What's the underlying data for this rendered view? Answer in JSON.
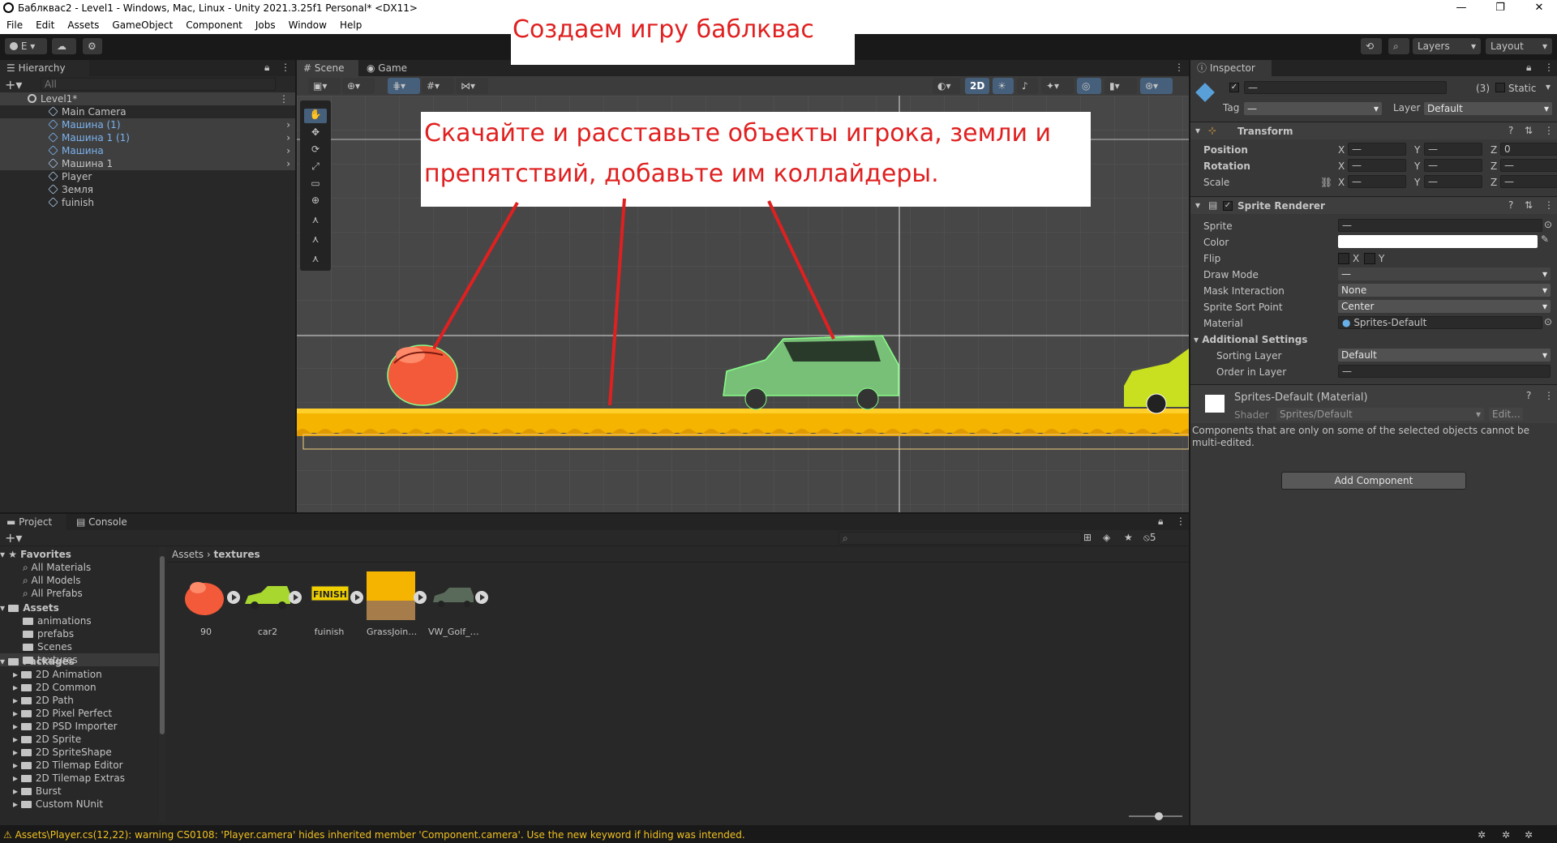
{
  "window": {
    "title": "Баблквас2 - Level1 - Windows, Mac, Linux - Unity 2021.3.25f1 Personal* <DX11>",
    "minimize": "—",
    "maximize": "❐",
    "close": "✕"
  },
  "menu": [
    "File",
    "Edit",
    "Assets",
    "GameObject",
    "Component",
    "Jobs",
    "Window",
    "Help"
  ],
  "toolbar": {
    "account": "E",
    "layers": "Layers",
    "layout": "Layout"
  },
  "overlay": {
    "title": "Создаем игру баблквас",
    "instruction": "Скачайте и расставьте объекты игрока, земли и препятствий, добавьте им коллайдеры.",
    "accent_color": "#e02020"
  },
  "hierarchy": {
    "tab": "Hierarchy",
    "search_placeholder": "All",
    "scene": "Level1*",
    "items": [
      {
        "name": "Main Camera",
        "prefab": false,
        "arrow": false
      },
      {
        "name": "Машина (1)",
        "prefab": true,
        "arrow": true
      },
      {
        "name": "Машина 1 (1)",
        "prefab": true,
        "arrow": true
      },
      {
        "name": "Машина",
        "prefab": true,
        "arrow": true
      },
      {
        "name": "Машина 1",
        "prefab": false,
        "arrow": true
      },
      {
        "name": "Player",
        "prefab": false,
        "arrow": false
      },
      {
        "name": "Земля",
        "prefab": false,
        "arrow": false
      },
      {
        "name": "fuinish",
        "prefab": false,
        "arrow": false
      }
    ]
  },
  "scene_view": {
    "tab_scene": "Scene",
    "tab_game": "Game",
    "mode_2d": "2D"
  },
  "inspector": {
    "tab": "Inspector",
    "name_value": "—",
    "multi_count": "(3)",
    "static_label": "Static",
    "tag_label": "Tag",
    "tag_value": "—",
    "layer_label": "Layer",
    "layer_value": "Default",
    "transform": {
      "title": "Transform",
      "position": "Position",
      "rotation": "Rotation",
      "scale": "Scale",
      "x": "X",
      "y": "Y",
      "z": "Z",
      "dash": "—",
      "pos_z": "0"
    },
    "sprite_renderer": {
      "title": "Sprite Renderer",
      "sprite": "Sprite",
      "sprite_value": "—",
      "color": "Color",
      "flip": "Flip",
      "flip_x": "X",
      "flip_y": "Y",
      "draw_mode": "Draw Mode",
      "draw_mode_value": "—",
      "mask_interaction": "Mask Interaction",
      "mask_value": "None",
      "sort_point": "Sprite Sort Point",
      "sort_point_value": "Center",
      "material": "Material",
      "material_value": "Sprites-Default",
      "additional": "Additional Settings",
      "sorting_layer": "Sorting Layer",
      "sorting_layer_value": "Default",
      "order": "Order in Layer",
      "order_value": "—"
    },
    "material_block": {
      "title": "Sprites-Default (Material)",
      "shader_label": "Shader",
      "shader_value": "Sprites/Default",
      "edit": "Edit..."
    },
    "note": "Components that are only on some of the selected objects cannot be multi-edited.",
    "add_component": "Add Component"
  },
  "project": {
    "tab_project": "Project",
    "tab_console": "Console",
    "breadcrumb_root": "Assets",
    "breadcrumb_sep": "›",
    "breadcrumb_current": "textures",
    "hidden_count": "5",
    "favorites_label": "Favorites",
    "favorites": [
      "All Materials",
      "All Models",
      "All Prefabs"
    ],
    "assets_label": "Assets",
    "assets": [
      "animations",
      "prefabs",
      "Scenes",
      "textures"
    ],
    "packages_label": "Packages",
    "packages": [
      "2D Animation",
      "2D Common",
      "2D Path",
      "2D Pixel Perfect",
      "2D PSD Importer",
      "2D Sprite",
      "2D SpriteShape",
      "2D Tilemap Editor",
      "2D Tilemap Extras",
      "Burst",
      "Custom NUnit"
    ],
    "files": [
      "90",
      "car2",
      "fuinish",
      "GrassJoinHi...",
      "VW_Golf_II..."
    ],
    "finish_sign": "FINISH"
  },
  "status": {
    "message": "Assets\\Player.cs(12,22): warning CS0108: 'Player.camera' hides inherited member 'Component.camera'. Use the new keyword if hiding was intended."
  }
}
